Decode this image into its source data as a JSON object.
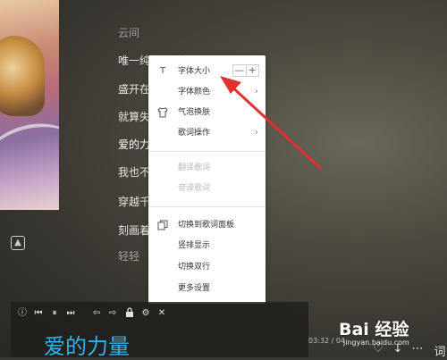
{
  "lyrics": [
    {
      "text": "云间",
      "state": "dim"
    },
    {
      "text": "唯一纯真的梦想",
      "state": "normal"
    },
    {
      "text": "盛开在",
      "state": "normal"
    },
    {
      "text": "就算失",
      "state": "normal"
    },
    {
      "text": "爱的力",
      "state": "active"
    },
    {
      "text": "我也不",
      "state": "normal"
    },
    {
      "text": "穿越千",
      "state": "normal"
    },
    {
      "text": "刻画着",
      "state": "normal"
    },
    {
      "text": "轻轻",
      "state": "dim"
    }
  ],
  "context_menu": {
    "items": [
      {
        "label": "字体大小",
        "icon": "text-T-icon",
        "enabled": true,
        "has_stepper": true
      },
      {
        "label": "字体颜色",
        "icon": "",
        "enabled": true,
        "has_submenu": true
      },
      {
        "label": "气泡换肤",
        "icon": "shirt-icon",
        "enabled": true
      },
      {
        "label": "歌词操作",
        "icon": "",
        "enabled": true,
        "has_submenu": true
      },
      {
        "label": "翻译歌词",
        "icon": "",
        "enabled": false
      },
      {
        "label": "音译歌词",
        "icon": "",
        "enabled": false
      },
      {
        "label": "切换到歌词面板",
        "icon": "panel-icon",
        "enabled": true
      },
      {
        "label": "竖排显示",
        "icon": "",
        "enabled": true
      },
      {
        "label": "切换双行",
        "icon": "",
        "enabled": true
      },
      {
        "label": "更多设置",
        "icon": "",
        "enabled": true
      }
    ],
    "stepper": {
      "minus": "—",
      "plus": "+"
    },
    "submenu_arrow": "›"
  },
  "player_bar": {
    "current_lyric": "爱的力量",
    "time": "03:32 / 04",
    "controls": [
      "info-icon",
      "prev-icon",
      "pause-icon",
      "next-icon",
      "back-icon",
      "forward-icon",
      "lock-icon",
      "settings-icon",
      "close-icon"
    ]
  },
  "right_buttons": {
    "heart": "♡",
    "download": "↓",
    "more": "⋯",
    "lyric_label": "词"
  },
  "watermark": {
    "logo": "Bai 经验",
    "url": "jingyan.baidu.com"
  },
  "colors": {
    "accent": "#33b3ea",
    "annotation": "#e03030"
  }
}
